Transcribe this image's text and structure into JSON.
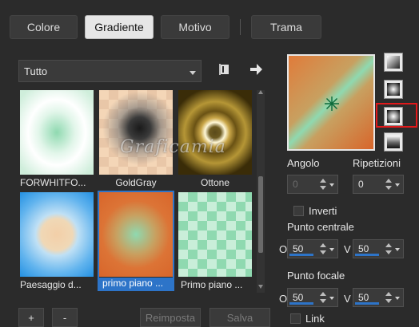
{
  "tabs": [
    {
      "label": "Colore"
    },
    {
      "label": "Gradiente"
    },
    {
      "label": "Motivo"
    },
    {
      "label": "Trama"
    }
  ],
  "category": {
    "selected": "Tutto"
  },
  "gradients": [
    {
      "label": "FORWHITFO..."
    },
    {
      "label": "GoldGray"
    },
    {
      "label": "Ottone"
    },
    {
      "label": "Paesaggio d..."
    },
    {
      "label": "primo piano ..."
    },
    {
      "label": "Primo piano ..."
    }
  ],
  "watermark": "Graficamia",
  "footer": {
    "add": "+",
    "remove": "-",
    "reset": "Reimposta",
    "save": "Salva"
  },
  "angle": {
    "label": "Angolo",
    "value": "0"
  },
  "repeats": {
    "label": "Ripetizioni",
    "value": "0"
  },
  "invert": {
    "label": "Inverti"
  },
  "center": {
    "label": "Punto centrale",
    "o_label": "O",
    "v_label": "V",
    "o_value": "50",
    "v_value": "50"
  },
  "focal": {
    "label": "Punto focale",
    "o_label": "O",
    "v_label": "V",
    "o_value": "50",
    "v_value": "50"
  },
  "link": {
    "label": "Link"
  },
  "colors": {
    "accent": "#2d74c8",
    "highlight_box": "#e0191b"
  }
}
